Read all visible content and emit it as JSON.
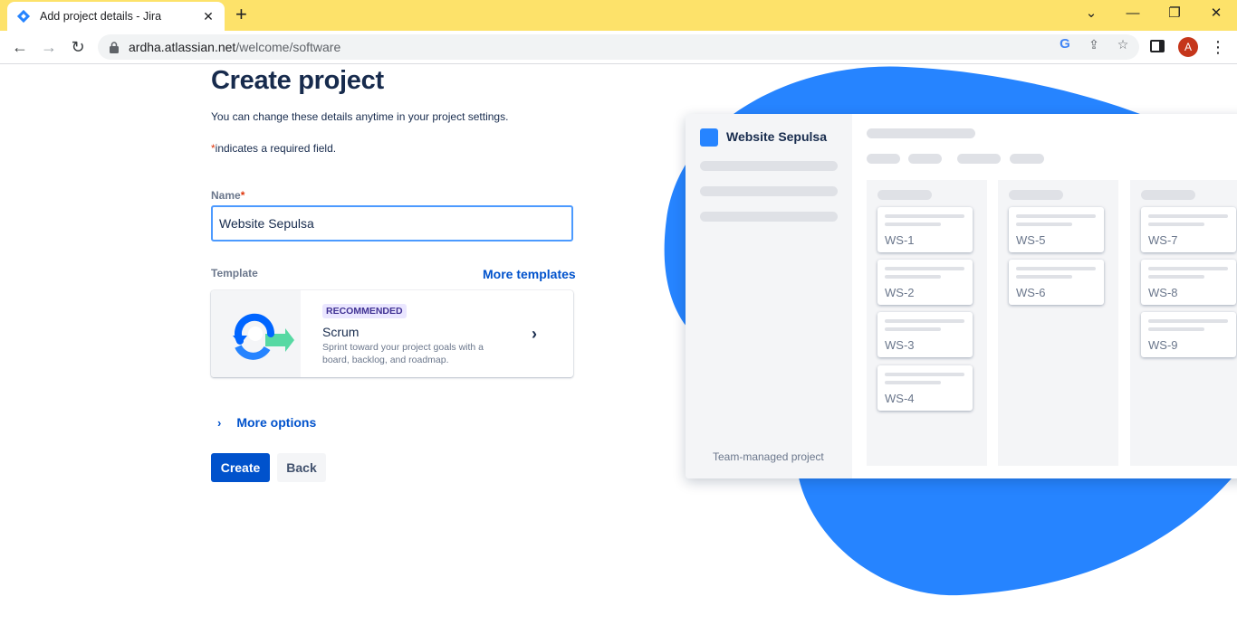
{
  "browser": {
    "tab_title": "Add project details - Jira",
    "new_tab": "+",
    "url_host": "ardha.atlassian.net",
    "url_path": "/welcome/software",
    "profile_initial": "A",
    "close_tab": "✕"
  },
  "form": {
    "title": "Create project",
    "subtitle": "You can change these details anytime in your project settings.",
    "required_star": "*",
    "required_note": "indicates a required field.",
    "name_label": "Name",
    "name_value": "Website Sepulsa",
    "template_label": "Template",
    "more_templates": "More templates",
    "template": {
      "badge": "RECOMMENDED",
      "name": "Scrum",
      "description": "Sprint toward your project goals with a board, backlog, and roadmap."
    },
    "more_options": "More options",
    "create_button": "Create",
    "back_button": "Back"
  },
  "preview": {
    "project_name": "Website Sepulsa",
    "footer": "Team-managed project",
    "columns": [
      [
        "WS-1",
        "WS-2",
        "WS-3",
        "WS-4"
      ],
      [
        "WS-5",
        "WS-6"
      ],
      [
        "WS-7",
        "WS-8",
        "WS-9"
      ]
    ]
  },
  "colors": {
    "accent": "#0052cc",
    "blob": "#2684ff",
    "tabstrip": "#fde26a"
  }
}
